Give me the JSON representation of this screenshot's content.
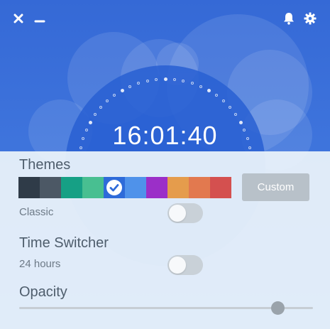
{
  "titlebar": {
    "close_icon": "close-icon",
    "minimize_icon": "minimize-icon",
    "bell_icon": "bell-icon",
    "gear_icon": "gear-icon"
  },
  "clock": {
    "time": "16:01:40"
  },
  "themes": {
    "title": "Themes",
    "swatches": [
      {
        "color": "#2f3b48",
        "selected": false
      },
      {
        "color": "#4c5865",
        "selected": false
      },
      {
        "color": "#16a085",
        "selected": false
      },
      {
        "color": "#48bf91",
        "selected": false
      },
      {
        "color": "#2e6bd9",
        "selected": true
      },
      {
        "color": "#4f92ea",
        "selected": false
      },
      {
        "color": "#9b2fc8",
        "selected": false
      },
      {
        "color": "#e59c4c",
        "selected": false
      },
      {
        "color": "#e2794f",
        "selected": false
      },
      {
        "color": "#d4504f",
        "selected": false
      }
    ],
    "custom_label": "Custom",
    "classic_label": "Classic",
    "classic_enabled": false
  },
  "time_switcher": {
    "title": "Time Switcher",
    "label": "24 hours",
    "enabled": false
  },
  "opacity": {
    "title": "Opacity",
    "value": 0.88
  },
  "colors": {
    "accent": "#3569d6",
    "panel": "#eaf2fa"
  }
}
